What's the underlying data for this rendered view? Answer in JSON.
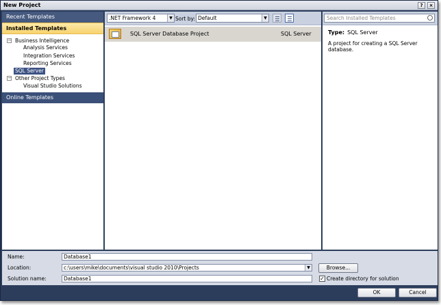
{
  "window": {
    "title": "New Project",
    "help_glyph": "?",
    "close_glyph": "×"
  },
  "sidebar": {
    "recent": "Recent Templates",
    "installed": "Installed Templates",
    "online": "Online Templates",
    "tree": {
      "business_intelligence": "Business Intelligence",
      "analysis_services": "Analysis Services",
      "integration_services": "Integration Services",
      "reporting_services": "Reporting Services",
      "sql_server": "SQL Server",
      "other_project_types": "Other Project Types",
      "visual_studio_solutions": "Visual Studio Solutions",
      "collapse_glyph": "−"
    }
  },
  "toolbar": {
    "framework": ".NET Framework 4",
    "sort_label": "Sort by:",
    "sort_value": "Default",
    "dropdown_glyph": "▼"
  },
  "templates": [
    {
      "name": "SQL Server Database Project",
      "type": "SQL Server",
      "selected": true
    }
  ],
  "details": {
    "search_placeholder": "Search Installed Templates",
    "type_label": "Type:",
    "type_value": "SQL Server",
    "description": "A project for creating a SQL Server database."
  },
  "form": {
    "name_label": "Name:",
    "name_value": "Database1",
    "location_label": "Location:",
    "location_value": "c:\\users\\mike\\documents\\visual studio 2010\\Projects",
    "solution_label": "Solution name:",
    "solution_value": "Database1",
    "browse": "Browse...",
    "create_dir": "Create directory for solution",
    "create_dir_checked": true,
    "check_glyph": "✓"
  },
  "buttons": {
    "ok": "OK",
    "cancel": "Cancel"
  },
  "colors": {
    "frame": "#2c3d5c",
    "selection": "#3d5284",
    "installed_header": "#f7d36f"
  }
}
